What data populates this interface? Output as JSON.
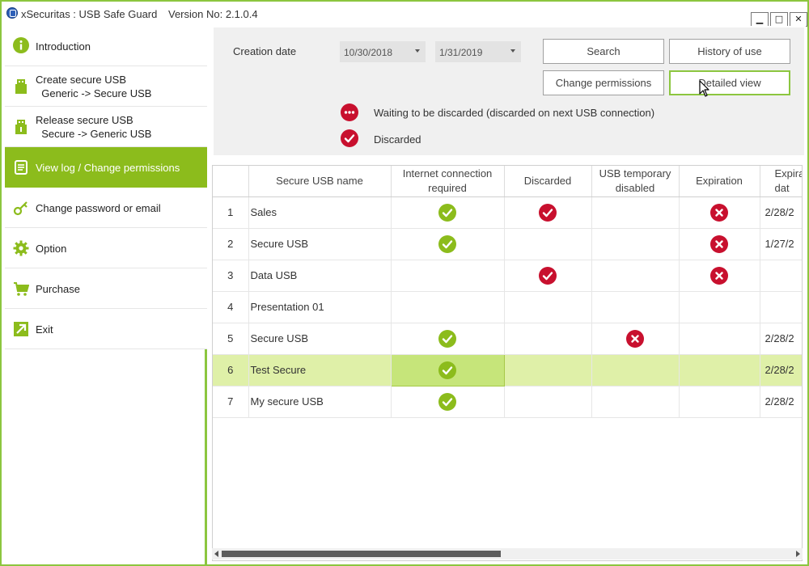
{
  "window": {
    "title": "xSecuritas : USB Safe Guard",
    "version": "Version No: 2.1.0.4",
    "controls": {
      "minimize": "▁",
      "maximize": "□",
      "close": "✕"
    }
  },
  "sidebar": {
    "items": [
      {
        "label": "Introduction",
        "icon": "info-icon"
      },
      {
        "label": "Create secure USB\n  Generic -> Secure USB",
        "icon": "usb-icon"
      },
      {
        "label": "Release secure USB\n  Secure -> Generic USB",
        "icon": "usb-icon"
      },
      {
        "label": "View log / Change permissions",
        "icon": "log-icon",
        "active": true
      },
      {
        "label": "Change password or email",
        "icon": "key-icon"
      },
      {
        "label": "Option",
        "icon": "gear-icon"
      },
      {
        "label": "Purchase",
        "icon": "cart-icon"
      },
      {
        "label": "Exit",
        "icon": "exit-icon"
      }
    ]
  },
  "filter": {
    "creation_date_label": "Creation date",
    "date_from": "10/30/2018",
    "date_to": "1/31/2019",
    "search_button": "Search",
    "history_button": "History of use",
    "change_permissions_button": "Change permissions",
    "detailed_view_button": "Detailed view"
  },
  "legend": {
    "waiting": "Waiting to be discarded (discarded on next USB connection)",
    "discarded": "Discarded"
  },
  "table": {
    "columns": [
      "",
      "Secure USB name",
      "Internet connection\nrequired",
      "Discarded",
      "USB temporary\ndisabled",
      "Expiration",
      "Expira\ndat"
    ],
    "rows": [
      {
        "no": "1",
        "name": "Sales",
        "internet": "ok",
        "discarded": "discarded",
        "temp_disabled": "",
        "expiration": "expired",
        "exp_date": "2/28/2"
      },
      {
        "no": "2",
        "name": "Secure USB",
        "internet": "ok",
        "discarded": "",
        "temp_disabled": "",
        "expiration": "expired",
        "exp_date": "1/27/2"
      },
      {
        "no": "3",
        "name": "Data USB",
        "internet": "",
        "discarded": "discarded",
        "temp_disabled": "",
        "expiration": "expired",
        "exp_date": ""
      },
      {
        "no": "4",
        "name": "Presentation 01",
        "internet": "",
        "discarded": "",
        "temp_disabled": "",
        "expiration": "",
        "exp_date": ""
      },
      {
        "no": "5",
        "name": "Secure USB",
        "internet": "ok",
        "discarded": "",
        "temp_disabled": "disabled",
        "expiration": "",
        "exp_date": "2/28/2"
      },
      {
        "no": "6",
        "name": "Test Secure",
        "internet": "ok",
        "discarded": "",
        "temp_disabled": "",
        "expiration": "",
        "exp_date": "2/28/2",
        "selected": true
      },
      {
        "no": "7",
        "name": "My secure USB",
        "internet": "ok",
        "discarded": "",
        "temp_disabled": "",
        "expiration": "",
        "exp_date": "2/28/2"
      }
    ]
  },
  "colors": {
    "accent": "#8cbc1c",
    "border": "#8cc63f",
    "status_red": "#c8102e",
    "selected_row": "#dff0a8"
  }
}
